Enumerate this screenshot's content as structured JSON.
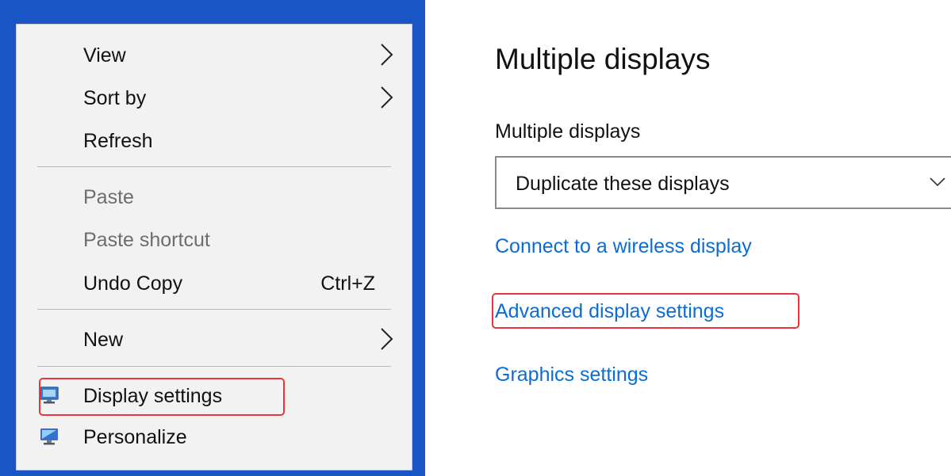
{
  "context_menu": {
    "items": [
      {
        "label": "View",
        "has_submenu": true,
        "enabled": true
      },
      {
        "label": "Sort by",
        "has_submenu": true,
        "enabled": true
      },
      {
        "label": "Refresh",
        "has_submenu": false,
        "enabled": true
      },
      {
        "label": "Paste",
        "has_submenu": false,
        "enabled": false
      },
      {
        "label": "Paste shortcut",
        "has_submenu": false,
        "enabled": false
      },
      {
        "label": "Undo Copy",
        "shortcut": "Ctrl+Z",
        "has_submenu": false,
        "enabled": true
      },
      {
        "label": "New",
        "has_submenu": true,
        "enabled": true
      },
      {
        "label": "Display settings",
        "icon": "monitor-icon",
        "highlighted": true,
        "enabled": true
      },
      {
        "label": "Personalize",
        "icon": "personalize-icon",
        "enabled": true
      }
    ]
  },
  "settings": {
    "title": "Multiple displays",
    "field_label": "Multiple displays",
    "dropdown_value": "Duplicate these displays",
    "links": [
      {
        "label": "Connect to a wireless display",
        "highlighted": false
      },
      {
        "label": "Advanced display settings",
        "highlighted": true
      },
      {
        "label": "Graphics settings",
        "highlighted": false
      }
    ]
  },
  "colors": {
    "desktop_bg": "#1a55c5",
    "menu_bg": "#f2f2f2",
    "link": "#0b6cd4",
    "highlight_border": "#e8343f"
  }
}
